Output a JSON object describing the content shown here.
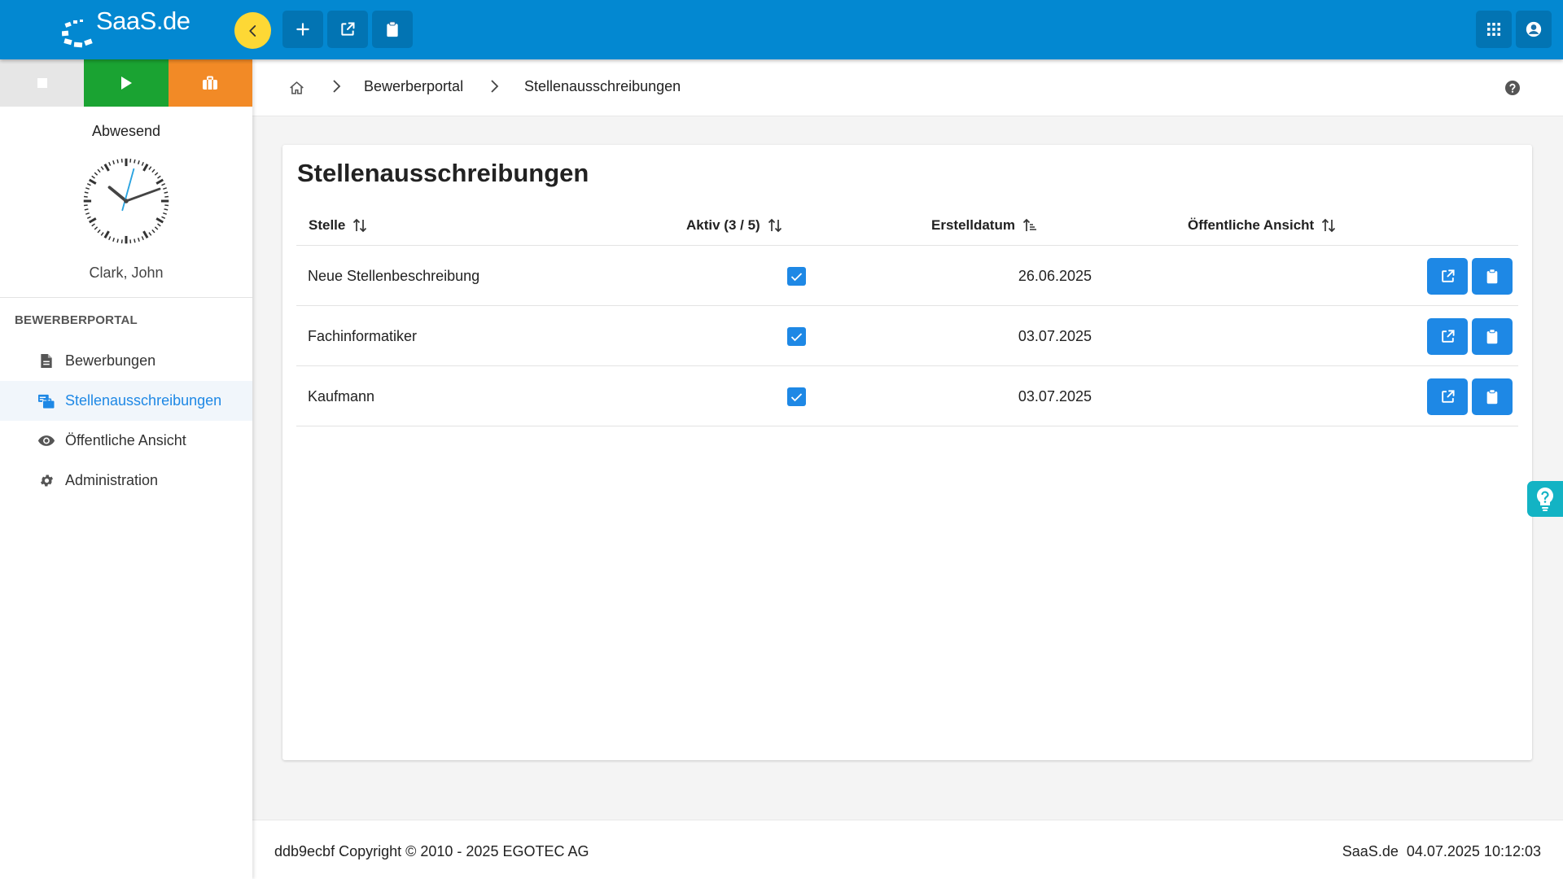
{
  "app": {
    "logo_text": "SaaS.de",
    "brand_color": "#0388d1",
    "accent_color": "#1e88e5"
  },
  "topbar": {
    "collapse_icon": "chevron-left-icon",
    "buttons": [
      "plus-icon",
      "external-link-icon",
      "clipboard-icon"
    ],
    "right_buttons": [
      "apps-grid-icon",
      "account-circle-icon"
    ]
  },
  "sidebar": {
    "status_buttons": [
      {
        "icon": "stop-icon",
        "color": "#e6e6e6"
      },
      {
        "icon": "play-icon",
        "color": "#1aa332"
      },
      {
        "icon": "briefcase-icon",
        "color": "#f28a26"
      }
    ],
    "status_text": "Abwesend",
    "clock_time": "10:12",
    "user_name": "Clark, John",
    "section_title": "BEWERBERPORTAL",
    "items": [
      {
        "label": "Bewerbungen",
        "icon": "document-icon",
        "active": false
      },
      {
        "label": "Stellenausschreibungen",
        "icon": "job-postings-icon",
        "active": true
      },
      {
        "label": "Öffentliche Ansicht",
        "icon": "eye-icon",
        "active": false
      },
      {
        "label": "Administration",
        "icon": "gear-icon",
        "active": false
      }
    ]
  },
  "breadcrumb": {
    "home_icon": "home-icon",
    "items": [
      "Bewerberportal",
      "Stellenausschreibungen"
    ],
    "help_icon": "help-circle-icon"
  },
  "main": {
    "title": "Stellenausschreibungen",
    "columns": [
      {
        "label": "Stelle",
        "sort": "none"
      },
      {
        "label": "Aktiv (3 / 5)",
        "sort": "none"
      },
      {
        "label": "Erstelldatum",
        "sort": "ascending"
      },
      {
        "label": "Öffentliche Ansicht",
        "sort": "none"
      }
    ],
    "rows": [
      {
        "stelle": "Neue Stellenbeschreibung",
        "aktiv": true,
        "erstelldatum": "26.06.2025"
      },
      {
        "stelle": "Fachinformatiker",
        "aktiv": true,
        "erstelldatum": "03.07.2025"
      },
      {
        "stelle": "Kaufmann",
        "aktiv": true,
        "erstelldatum": "03.07.2025"
      }
    ],
    "row_actions": [
      "external-link-icon",
      "clipboard-icon"
    ]
  },
  "footer": {
    "left": "ddb9ecbf Copyright © 2010 - 2025 EGOTEC AG",
    "right": "SaaS.de  04.07.2025 10:12:03"
  },
  "help_tab": {
    "icon": "lightbulb-question-icon",
    "color": "#13b3c4"
  }
}
